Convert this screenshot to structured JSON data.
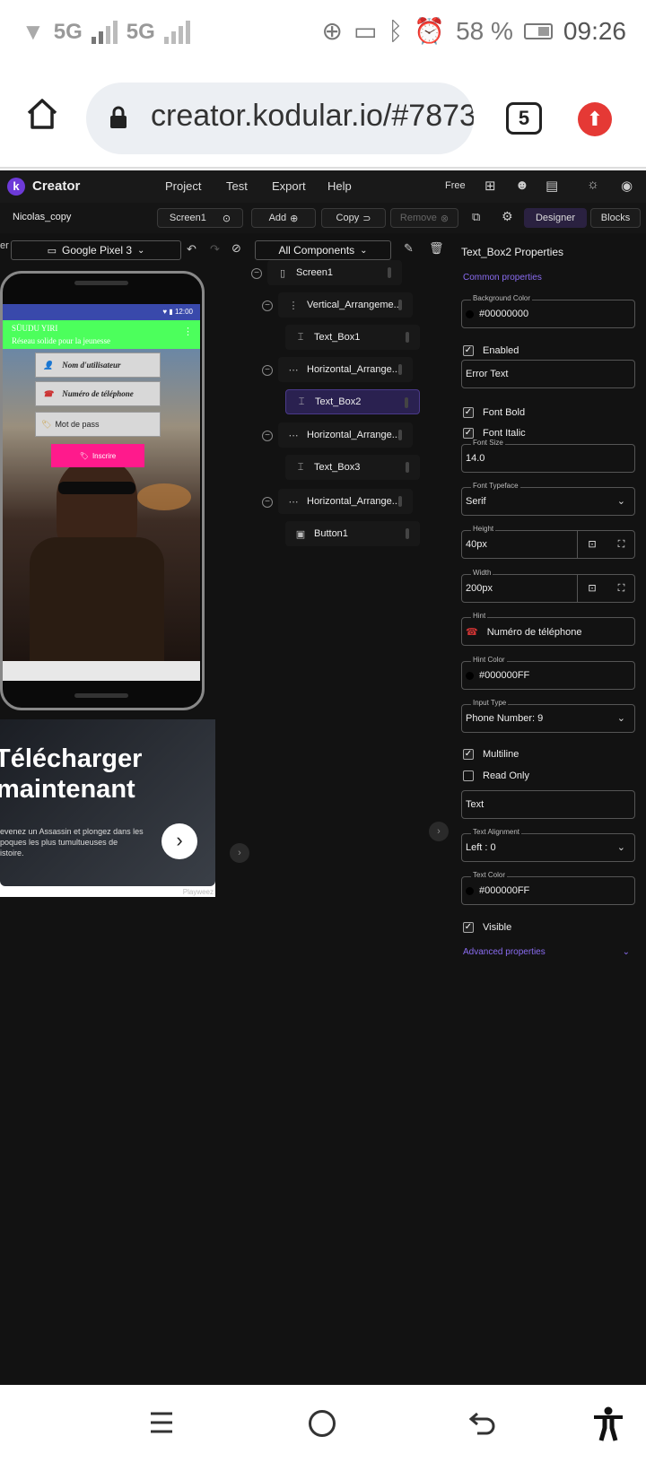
{
  "status_bar": {
    "net1": "5G",
    "net2": "5G",
    "battery": "58 %",
    "time": "09:26"
  },
  "browser": {
    "url": "creator.kodular.io/#7873",
    "tab_count": "5"
  },
  "app": {
    "brand": "Creator",
    "menu": [
      "Project",
      "Test",
      "Export",
      "Help"
    ],
    "plan": "Free",
    "project_name": "Nicolas_copy",
    "screen_select": "Screen1",
    "add_label": "Add",
    "copy_label": "Copy",
    "remove_label": "Remove",
    "designer_label": "Designer",
    "blocks_label": "Blocks",
    "device_select": "Google Pixel 3",
    "device_prefix": "er",
    "components_filter": "All Components"
  },
  "preview": {
    "status_time": "12:00",
    "title": "SÜUDU YIRI",
    "subtitle": "Réseau solide pour la jeunesse",
    "username_hint": "Nom d'utilisateur",
    "phone_hint": "Numéro de téléphone",
    "password_hint": "Mot de pass",
    "register_label": "Inscrire"
  },
  "ad": {
    "headline1": "Télécharger",
    "headline2": "maintenant",
    "body1": "evenez un Assassin et plongez dans les",
    "body2": "poques les plus tumultueuses de",
    "body3": "istoire.",
    "brand": "Playweez"
  },
  "tree": [
    {
      "label": "Screen1",
      "icon": "phone-icon"
    },
    {
      "label": "Vertical_Arrangeme...",
      "icon": "vertical-arrangement-icon"
    },
    {
      "label": "Text_Box1",
      "icon": "textbox-icon"
    },
    {
      "label": "Horizontal_Arrange...",
      "icon": "horizontal-arrangement-icon"
    },
    {
      "label": "Text_Box2",
      "icon": "textbox-icon"
    },
    {
      "label": "Horizontal_Arrange...",
      "icon": "horizontal-arrangement-icon"
    },
    {
      "label": "Text_Box3",
      "icon": "textbox-icon"
    },
    {
      "label": "Horizontal_Arrange...",
      "icon": "horizontal-arrangement-icon"
    },
    {
      "label": "Button1",
      "icon": "button-icon"
    }
  ],
  "properties": {
    "header": "Text_Box2 Properties",
    "common_label": "Common properties",
    "bg_color_label": "Background Color",
    "bg_color_value": "#00000000",
    "enabled_label": "Enabled",
    "error_text_value": "Error Text",
    "font_bold_label": "Font Bold",
    "font_italic_label": "Font Italic",
    "font_size_label": "Font Size",
    "font_size_value": "14.0",
    "font_typeface_label": "Font Typeface",
    "font_typeface_value": "Serif",
    "height_label": "Height",
    "height_value": "40px",
    "width_label": "Width",
    "width_value": "200px",
    "hint_label": "Hint",
    "hint_value": "Numéro de téléphone",
    "hint_color_label": "Hint Color",
    "hint_color_value": "#000000FF",
    "input_type_label": "Input Type",
    "input_type_value": "Phone Number: 9",
    "multiline_label": "Multiline",
    "read_only_label": "Read Only",
    "text_value": "Text",
    "text_alignment_label": "Text Alignment",
    "text_alignment_value": "Left : 0",
    "text_color_label": "Text Color",
    "text_color_value": "#000000FF",
    "visible_label": "Visible",
    "advanced_label": "Advanced properties"
  },
  "colors": {
    "accent": "#6d3ad8",
    "preview_header": "#4cff5c",
    "register_button": "#ff1a8c"
  }
}
